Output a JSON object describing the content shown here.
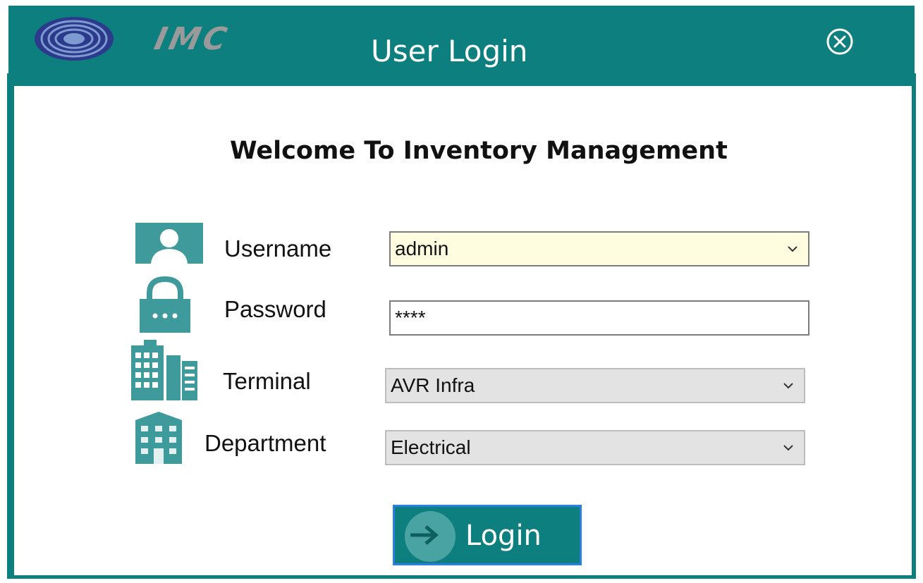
{
  "window": {
    "brand": "IMC",
    "title": "User Login"
  },
  "form": {
    "welcome": "Welcome To Inventory Management",
    "username_label": "Username",
    "username_value": "admin",
    "password_label": "Password",
    "password_value": "****",
    "terminal_label": "Terminal",
    "terminal_value": "AVR Infra",
    "department_label": "Department",
    "department_value": "Electrical",
    "login_label": "Login"
  },
  "icons": {
    "logo": "concentric-rings-logo-icon",
    "close": "close-circle-icon",
    "username": "user-icon",
    "password": "padlock-icon",
    "terminal": "buildings-icon",
    "department": "office-building-icon",
    "login": "arrow-right-icon",
    "dropdown": "chevron-down-icon"
  },
  "colors": {
    "window_background": "#0e7f7f",
    "icon_teal": "#3f9b9b",
    "username_field_background": "#fffde0",
    "select_background": "#e3e3e3",
    "login_border": "#2a7fe0"
  }
}
